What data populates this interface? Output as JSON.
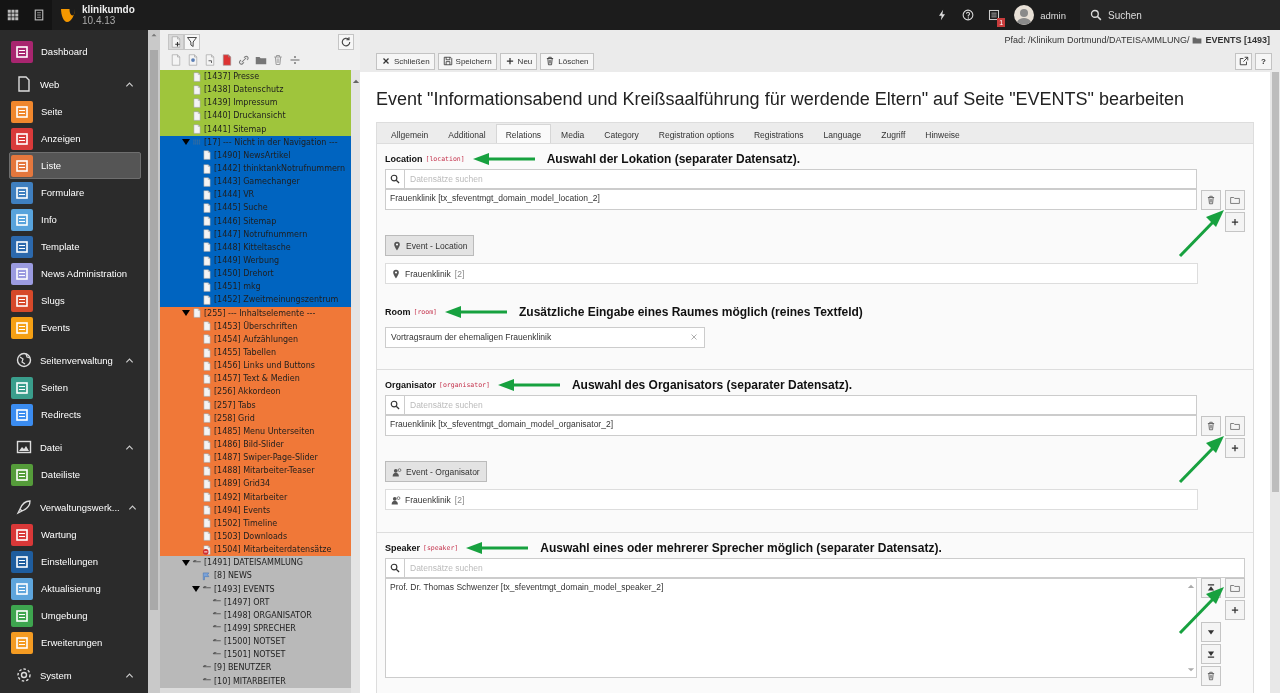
{
  "topbar": {
    "site_name": "klinikumdo",
    "version": "10.4.13",
    "notification_count": "1",
    "user": "admin",
    "search_label": "Suchen"
  },
  "modules": [
    {
      "kind": "item",
      "label": "Dashboard",
      "color": "#a8256f",
      "selected": false
    },
    {
      "kind": "group",
      "label": "Web",
      "expanded": true,
      "items": [
        {
          "label": "Seite",
          "color": "#f0872d",
          "selected": false
        },
        {
          "label": "Anzeigen",
          "color": "#d93a3a",
          "selected": false
        },
        {
          "label": "Liste",
          "color": "#e4773d",
          "selected": true
        },
        {
          "label": "Formulare",
          "color": "#3f7fbf",
          "selected": false
        },
        {
          "label": "Info",
          "color": "#58a3dc",
          "selected": false
        },
        {
          "label": "Template",
          "color": "#2c69ad",
          "selected": false
        },
        {
          "label": "News Administration",
          "color": "#9b9be0",
          "selected": false
        },
        {
          "label": "Slugs",
          "color": "#d6492a",
          "selected": false
        },
        {
          "label": "Events",
          "color": "#f5a014",
          "selected": false
        }
      ]
    },
    {
      "kind": "group",
      "label": "Seitenverwaltung",
      "expanded": true,
      "items": [
        {
          "label": "Seiten",
          "color": "#3a9e8c",
          "selected": false
        },
        {
          "label": "Redirects",
          "color": "#3b8cf0",
          "selected": false
        }
      ]
    },
    {
      "kind": "group",
      "label": "Datei",
      "expanded": true,
      "items": [
        {
          "label": "Dateiliste",
          "color": "#559c3a",
          "selected": false
        }
      ]
    },
    {
      "kind": "group",
      "label": "Verwaltungswerk...",
      "expanded": true,
      "items": [
        {
          "label": "Wartung",
          "color": "#d93838",
          "selected": false
        },
        {
          "label": "Einstellungen",
          "color": "#1f5d9e",
          "selected": false
        },
        {
          "label": "Aktualisierung",
          "color": "#5ea5dc",
          "selected": false
        },
        {
          "label": "Umgebung",
          "color": "#3ea54f",
          "selected": false
        },
        {
          "label": "Erweiterungen",
          "color": "#f49b22",
          "selected": false
        }
      ]
    },
    {
      "kind": "group",
      "label": "System",
      "expanded": true
    }
  ],
  "tree": {
    "nodes": [
      {
        "label": "[1437] Presse",
        "kind": "page",
        "color": "#9fc53c"
      },
      {
        "label": "[1438] Datenschutz",
        "kind": "page",
        "color": "#9fc53c"
      },
      {
        "label": "[1439] Impressum",
        "kind": "page",
        "color": "#9fc53c"
      },
      {
        "label": "[1440] Druckansicht",
        "kind": "page",
        "color": "#9fc53c"
      },
      {
        "label": "[1441] Sitemap",
        "kind": "page",
        "color": "#9fc53c"
      },
      {
        "label": "[17] --- Nicht in der Navigation ---",
        "kind": "separator",
        "color": "#0064c0",
        "expanded": true,
        "children": [
          {
            "label": "[1490] NewsArtikel",
            "kind": "page"
          },
          {
            "label": "[1442] thinktankNotrufnummern",
            "kind": "page"
          },
          {
            "label": "[1443] Gamechanger",
            "kind": "page"
          },
          {
            "label": "[1444] VR",
            "kind": "page"
          },
          {
            "label": "[1445] Suche",
            "kind": "page"
          },
          {
            "label": "[1446] Sitemap",
            "kind": "page"
          },
          {
            "label": "[1447] Notrufnummern",
            "kind": "page"
          },
          {
            "label": "[1448] Kitteltasche",
            "kind": "page"
          },
          {
            "label": "[1449] Werbung",
            "kind": "page"
          },
          {
            "label": "[1450] Drehort",
            "kind": "page"
          },
          {
            "label": "[1451] mkg",
            "kind": "page"
          },
          {
            "label": "[1452] Zweitmeinungszentrum",
            "kind": "page"
          }
        ]
      },
      {
        "label": "[255] --- Inhaltselemente ---",
        "kind": "page",
        "color": "#f07838",
        "expanded": true,
        "children": [
          {
            "label": "[1453] Überschriften",
            "kind": "page"
          },
          {
            "label": "[1454] Aufzählungen",
            "kind": "page"
          },
          {
            "label": "[1455] Tabellen",
            "kind": "page"
          },
          {
            "label": "[1456] Links und Buttons",
            "kind": "page"
          },
          {
            "label": "[1457] Text & Medien",
            "kind": "page"
          },
          {
            "label": "[256] Akkordeon",
            "kind": "page"
          },
          {
            "label": "[257] Tabs",
            "kind": "page"
          },
          {
            "label": "[258] Grid",
            "kind": "page"
          },
          {
            "label": "[1485] Menu Unterseiten",
            "kind": "page"
          },
          {
            "label": "[1486] Bild-Slider",
            "kind": "page"
          },
          {
            "label": "[1487] Swiper-Page-Slider",
            "kind": "page"
          },
          {
            "label": "[1488] Mitarbeiter-Teaser",
            "kind": "page"
          },
          {
            "label": "[1489] Grid34",
            "kind": "page"
          },
          {
            "label": "[1492] Mitarbeiter",
            "kind": "page"
          },
          {
            "label": "[1494] Events",
            "kind": "page"
          },
          {
            "label": "[1502] Timeline",
            "kind": "page"
          },
          {
            "label": "[1503] Downloads",
            "kind": "page"
          },
          {
            "label": "[1504] Mitarbeiterdatensätze",
            "kind": "restricted"
          }
        ]
      },
      {
        "label": "[1491] DATEISAMMLUNG",
        "kind": "folder",
        "color": "#b9b9b9",
        "expanded": true,
        "children": [
          {
            "label": "[8] NEWS",
            "kind": "news-folder"
          },
          {
            "label": "[1493] EVENTS",
            "kind": "folder",
            "expanded": true,
            "children": [
              {
                "label": "[1497] ORT",
                "kind": "folder"
              },
              {
                "label": "[1498] ORGANISATOR",
                "kind": "folder"
              },
              {
                "label": "[1499] SPRECHER",
                "kind": "folder"
              },
              {
                "label": "[1500] NOTSET",
                "kind": "folder"
              },
              {
                "label": "[1501] NOTSET",
                "kind": "folder"
              }
            ]
          },
          {
            "label": "[9] BENUTZER",
            "kind": "folder"
          },
          {
            "label": "[10] MITARBEITER",
            "kind": "folder"
          }
        ]
      }
    ]
  },
  "docheader": {
    "path": "Pfad: /Klinikum Dortmund/DATEISAMMLUNG/",
    "page": "EVENTS [1493]",
    "buttons": [
      {
        "label": "Schließen",
        "kind": "close"
      },
      {
        "label": "Speichern",
        "kind": "save"
      },
      {
        "label": "Neu",
        "kind": "new"
      },
      {
        "label": "Löschen",
        "kind": "delete"
      }
    ],
    "help_label": "?"
  },
  "form": {
    "title": "Event \"Informationsabend und Kreißsaalführung für werdende Eltern\" auf Seite \"EVENTS\" bearbeiten",
    "tabs": [
      {
        "label": "Allgemein",
        "selected": false
      },
      {
        "label": "Additional",
        "selected": false
      },
      {
        "label": "Relations",
        "selected": true
      },
      {
        "label": "Media",
        "selected": false
      },
      {
        "label": "Category",
        "selected": false
      },
      {
        "label": "Registration options",
        "selected": false
      },
      {
        "label": "Registrations",
        "selected": false
      },
      {
        "label": "Language",
        "selected": false
      },
      {
        "label": "Zugriff",
        "selected": false
      },
      {
        "label": "Hinweise",
        "selected": false
      }
    ],
    "palettes": [
      {
        "fields": [
          {
            "kind": "relation",
            "label": "Location",
            "field": "[location]",
            "annotation": "Auswahl der Lokation (separater Datensatz).",
            "search_placeholder": "Datensätze suchen",
            "items": [
              "Frauenklinik [tx_sfeventmgt_domain_model_location_2]"
            ],
            "wizard": "Event - Location",
            "record": "Frauenklinik",
            "record_uid": "[2]"
          },
          {
            "kind": "text",
            "label": "Room",
            "field": "[room]",
            "annotation": "Zusätzliche Eingabe eines Raumes möglich (reines Textfeld)",
            "value": "Vortragsraum der ehemaligen Frauenklinik"
          }
        ]
      },
      {
        "fields": [
          {
            "kind": "relation",
            "label": "Organisator",
            "field": "[organisator]",
            "annotation": "Auswahl des Organisators (separater Datensatz).",
            "search_placeholder": "Datensätze suchen",
            "items": [
              "Frauenklinik [tx_sfeventmgt_domain_model_organisator_2]"
            ],
            "wizard": "Event - Organisator",
            "record": "Frauenklinik",
            "record_uid": "[2]"
          }
        ]
      },
      {
        "fields": [
          {
            "kind": "multi",
            "label": "Speaker",
            "field": "[speaker]",
            "annotation": "Auswahl eines oder mehrerer Sprecher möglich (separater Datensatz).",
            "search_placeholder": "Datensätze suchen",
            "items": [
              "Prof. Dr. Thomas Schwenzer [tx_sfeventmgt_domain_model_speaker_2]"
            ]
          }
        ]
      }
    ]
  }
}
